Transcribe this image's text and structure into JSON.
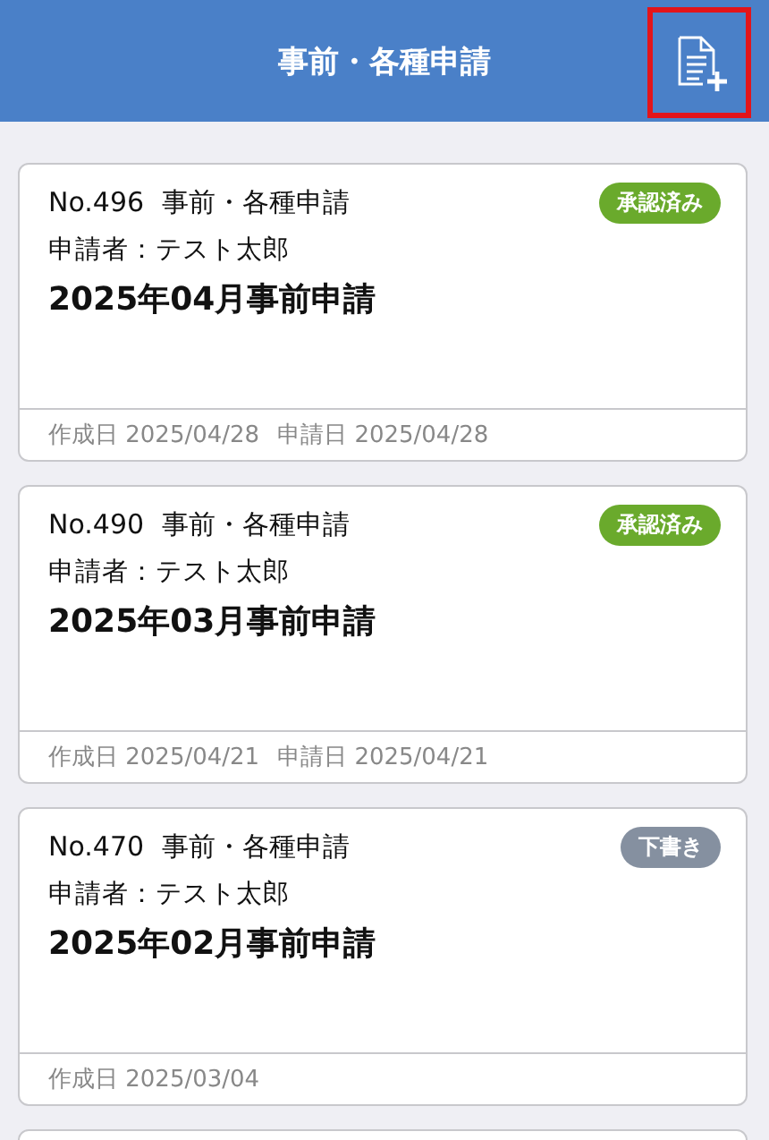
{
  "header": {
    "title": "事前・各種申請",
    "highlighted_action": true
  },
  "cards": [
    {
      "number": "No.496",
      "type": "事前・各種申請",
      "status": {
        "label": "承認済み",
        "kind": "approved"
      },
      "applicant": "申請者：テスト太郎",
      "title": "2025年04月事前申請",
      "dates": [
        {
          "label": "作成日",
          "value": "2025/04/28"
        },
        {
          "label": "申請日",
          "value": "2025/04/28"
        }
      ]
    },
    {
      "number": "No.490",
      "type": "事前・各種申請",
      "status": {
        "label": "承認済み",
        "kind": "approved"
      },
      "applicant": "申請者：テスト太郎",
      "title": "2025年03月事前申請",
      "dates": [
        {
          "label": "作成日",
          "value": "2025/04/21"
        },
        {
          "label": "申請日",
          "value": "2025/04/21"
        }
      ]
    },
    {
      "number": "No.470",
      "type": "事前・各種申請",
      "status": {
        "label": "下書き",
        "kind": "draft"
      },
      "applicant": "申請者：テスト太郎",
      "title": "2025年02月事前申請",
      "dates": [
        {
          "label": "作成日",
          "value": "2025/03/04"
        }
      ]
    }
  ]
}
